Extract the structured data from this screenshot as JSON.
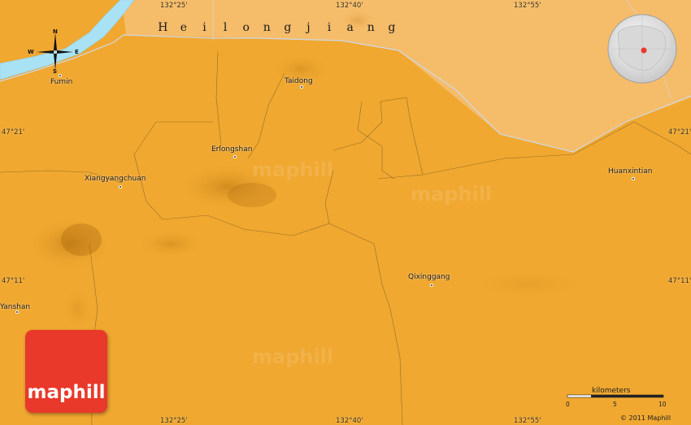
{
  "map": {
    "region_label": "Heilongjiang",
    "cities": [
      {
        "name": "Fumin"
      },
      {
        "name": "Taidong"
      },
      {
        "name": "Erlongshan"
      },
      {
        "name": "Xiangyangchuan"
      },
      {
        "name": "Huanxintian"
      },
      {
        "name": "Qixinggang"
      },
      {
        "name": "Yanshan"
      }
    ],
    "longitudes_top": [
      "132°25'",
      "132°40'",
      "132°55'"
    ],
    "longitudes_bottom": [
      "132°25'",
      "132°40'",
      "132°55'"
    ],
    "latitudes_left": [
      "47°21'",
      "47°11'"
    ],
    "latitudes_right": [
      "47°21'",
      "47°11'"
    ],
    "compass": {
      "n": "N",
      "s": "S",
      "e": "E",
      "w": "W"
    },
    "scale": {
      "title": "kilometers",
      "ticks": [
        "0",
        "5",
        "10"
      ]
    },
    "copyright": "© 2011 Maphill",
    "brand": "maphill",
    "watermark": "maphill",
    "colors": {
      "land": "#f0a830",
      "outside_region": "#f5bc6a",
      "river": "#a9e2f5",
      "border": "#cfd8e6",
      "brand": "#e8392a"
    }
  }
}
